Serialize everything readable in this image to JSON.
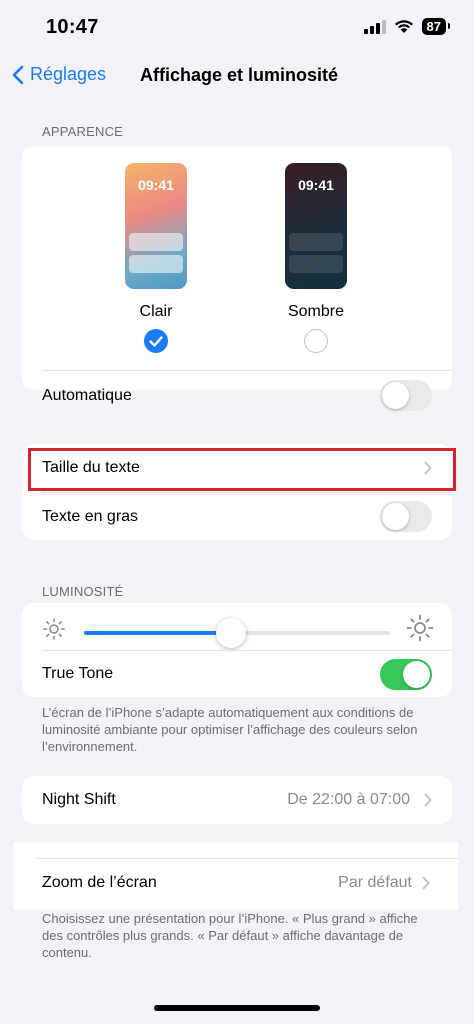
{
  "status": {
    "time": "10:47",
    "battery": "87"
  },
  "nav": {
    "back_label": "Réglages",
    "title": "Affichage et luminosité"
  },
  "appearance": {
    "header": "APPARENCE",
    "light": {
      "phone_time": "09:41",
      "label": "Clair",
      "selected": true
    },
    "dark": {
      "phone_time": "09:41",
      "label": "Sombre",
      "selected": false
    },
    "automatic_label": "Automatique",
    "automatic_on": false
  },
  "text": {
    "size_label": "Taille du texte",
    "bold_label": "Texte en gras",
    "bold_on": false
  },
  "brightness": {
    "header": "LUMINOSITÉ",
    "level": 0.48,
    "true_tone_label": "True Tone",
    "true_tone_on": true,
    "footnote": "L’écran de l’iPhone s’adapte automatiquement aux conditions de luminosité ambiante pour optimiser l’affichage des couleurs selon l’environnement."
  },
  "night_shift": {
    "label": "Night Shift",
    "value": "De 22:00 à 07:00"
  },
  "zoom": {
    "label": "Zoom de l’écran",
    "value": "Par défaut",
    "footnote": "Choisissez une présentation pour l’iPhone. « Plus grand » affiche des contrôles plus grands. « Par défaut » affiche davantage de contenu."
  },
  "colors": {
    "accent": "#1a7cf0",
    "toggle_on": "#34c759",
    "highlight": "#d8222f"
  }
}
